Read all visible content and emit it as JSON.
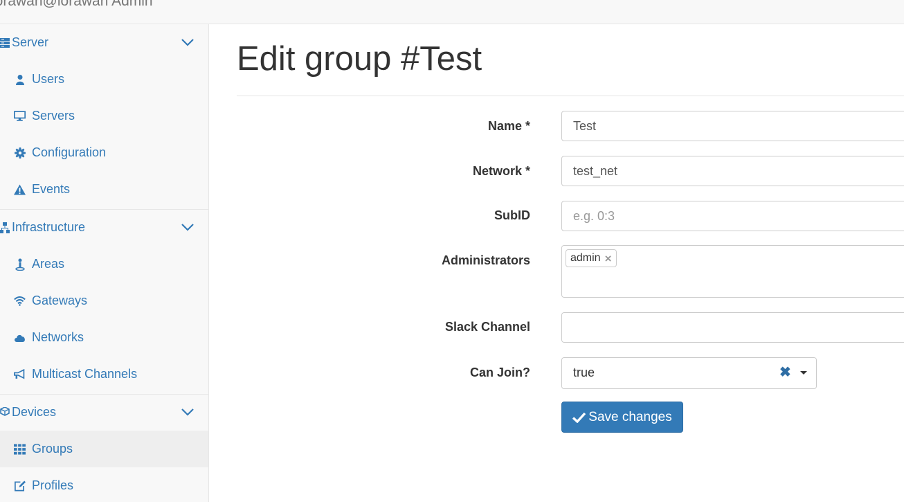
{
  "app": {
    "title": "lorawan@lorawan Admin"
  },
  "sidebar": {
    "sections": [
      {
        "label": "Server",
        "icon": "server-icon",
        "items": [
          {
            "label": "Users",
            "icon": "user-icon"
          },
          {
            "label": "Servers",
            "icon": "desktop-icon"
          },
          {
            "label": "Configuration",
            "icon": "cog-icon"
          },
          {
            "label": "Events",
            "icon": "warning-icon"
          }
        ]
      },
      {
        "label": "Infrastructure",
        "icon": "sitemap-icon",
        "items": [
          {
            "label": "Areas",
            "icon": "map-marker-icon"
          },
          {
            "label": "Gateways",
            "icon": "wifi-icon"
          },
          {
            "label": "Networks",
            "icon": "cloud-icon"
          },
          {
            "label": "Multicast Channels",
            "icon": "bullhorn-icon"
          }
        ]
      },
      {
        "label": "Devices",
        "icon": "cubes-icon",
        "items": [
          {
            "label": "Groups",
            "icon": "grid-icon",
            "active": true
          },
          {
            "label": "Profiles",
            "icon": "edit-icon"
          }
        ]
      }
    ]
  },
  "page": {
    "title": "Edit group #Test"
  },
  "form": {
    "name": {
      "label": "Name *",
      "value": "Test"
    },
    "network": {
      "label": "Network *",
      "value": "test_net"
    },
    "subid": {
      "label": "SubID",
      "value": "",
      "placeholder": "e.g. 0:3"
    },
    "administrators": {
      "label": "Administrators",
      "tags": [
        "admin"
      ]
    },
    "slack": {
      "label": "Slack Channel",
      "value": ""
    },
    "can_join": {
      "label": "Can Join?",
      "value": "true"
    },
    "save_label": "Save changes"
  },
  "colors": {
    "link": "#337ab7",
    "button": "#337ab7",
    "sidebar_bg": "#f8f8f8",
    "active_bg": "#eeeeee"
  }
}
